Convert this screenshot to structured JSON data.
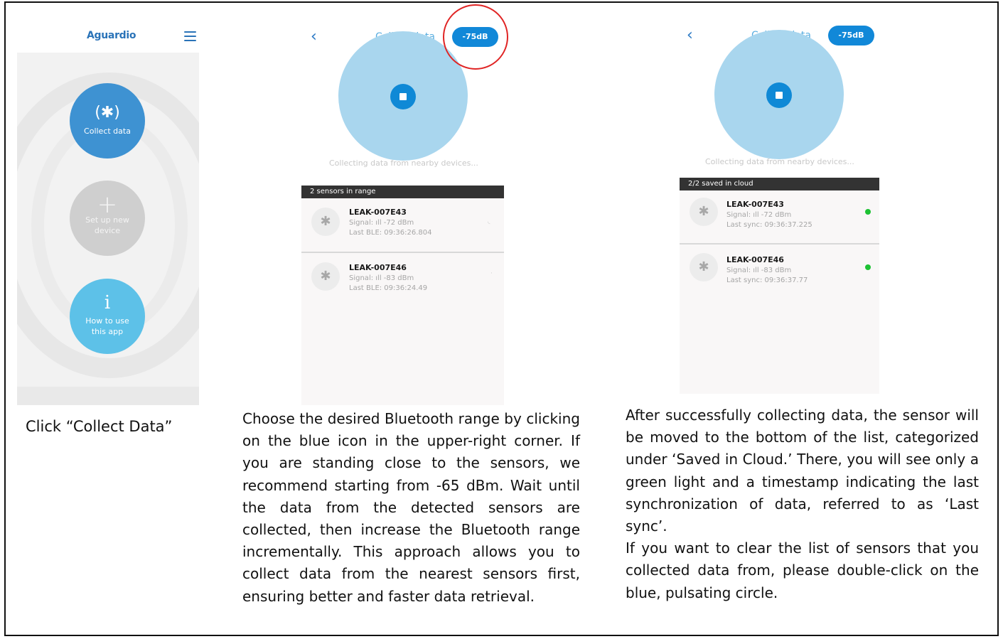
{
  "screen1": {
    "logo": "Aguardio",
    "buttons": {
      "collect": {
        "icon": "(✱)",
        "label": "Collect data"
      },
      "setup": {
        "icon": "+",
        "label_line1": "Set up new",
        "label_line2": "device"
      },
      "howto": {
        "icon": "i",
        "label_line1": "How to use",
        "label_line2": "this app"
      }
    }
  },
  "screen2": {
    "title": "Collect data",
    "range_pill": "-75dB",
    "status": "Collecting data from nearby devices...",
    "list_header": "2 sensors in range",
    "devices": [
      {
        "name": "LEAK-007E43",
        "signal": "Signal: ıll -72 dBm",
        "last": "Last BLE: 09:36:26.804"
      },
      {
        "name": "LEAK-007E46",
        "signal": "Signal: ıll -83 dBm",
        "last": "Last BLE: 09:36:24.49"
      }
    ]
  },
  "screen3": {
    "title": "Collect data",
    "range_pill": "-75dB",
    "status": "Collecting data from nearby devices...",
    "list_header": "2/2 saved in cloud",
    "devices": [
      {
        "name": "LEAK-007E43",
        "signal": "Signal: ıll -72 dBm",
        "last": "Last sync: 09:36:37.225"
      },
      {
        "name": "LEAK-007E46",
        "signal": "Signal: ıll -83 dBm",
        "last": "Last sync: 09:36:37.77"
      }
    ]
  },
  "captions": {
    "step1": "Click “Collect Data”",
    "step2": "Choose the desired Bluetooth range by clicking on the blue icon in the upper-right corner. If you are standing close to the sensors, we recommend starting from -65 dBm. Wait until the data from the detected sensors are collected, then increase the Bluetooth range incrementally. This approach allows you to collect data from the nearest sensors first, ensuring better and faster data retrieval.",
    "step3_a": "After successfully collecting data, the sensor will be moved to the bottom of the list, categorized under ‘Saved in Cloud.’ There, you will see only a green light and a timestamp indicating the last synchronization of data, referred to as ‘Last sync’.",
    "step3_b": "If you want to clear the list of sensors that you collected data from, please double-click on the blue, pulsating circle."
  },
  "colors": {
    "accent": "#1188d8",
    "collect_button": "#3e92d2",
    "howto_button": "#5dc1e8",
    "pulse_circle": "#a9d6ee",
    "saved_indicator": "#1ec234",
    "highlight_ring": "#e02424"
  }
}
